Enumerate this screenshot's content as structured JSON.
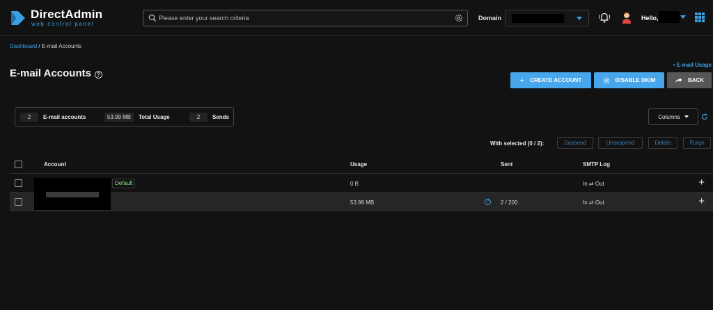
{
  "header": {
    "logo_title": "DirectAdmin",
    "logo_subtitle": "web control panel",
    "search_placeholder": "Please enter your search criteria",
    "domain_label": "Domain",
    "greeting": "Hello,"
  },
  "breadcrumb": {
    "home": "Dashboard",
    "separator": " / ",
    "current": "E-mail Accounts"
  },
  "page": {
    "title": "E-mail Accounts",
    "usage_link": "• E-mail Usage"
  },
  "actions": {
    "create": "CREATE ACCOUNT",
    "dkim": "DISABLE DKIM",
    "back": "BACK"
  },
  "stats": {
    "accounts_value": "2",
    "accounts_label": "E-mail accounts",
    "usage_value": "53.99 MB",
    "usage_label": "Total Usage",
    "sends_value": "2",
    "sends_label": "Sends"
  },
  "toolbar": {
    "columns": "Columns",
    "with_selected": "With selected (0 / 2):",
    "suspend": "Suspend",
    "unsuspend": "Unsuspend",
    "delete": "Delete",
    "purge": "Purge"
  },
  "table": {
    "headers": {
      "account": "Account",
      "usage": "Usage",
      "sent": "Sent",
      "smtp": "SMTP Log"
    },
    "rows": [
      {
        "badge": "Default",
        "usage": "0 B",
        "sent": "",
        "smtp": "In ⇄ Out"
      },
      {
        "badge": "",
        "usage": "53.99 MB",
        "sent": "2 / 200",
        "smtp": "In ⇄ Out"
      }
    ]
  },
  "colors": {
    "accent": "#48a7ec",
    "background": "#121212",
    "badge_green": "#8ee88e"
  }
}
